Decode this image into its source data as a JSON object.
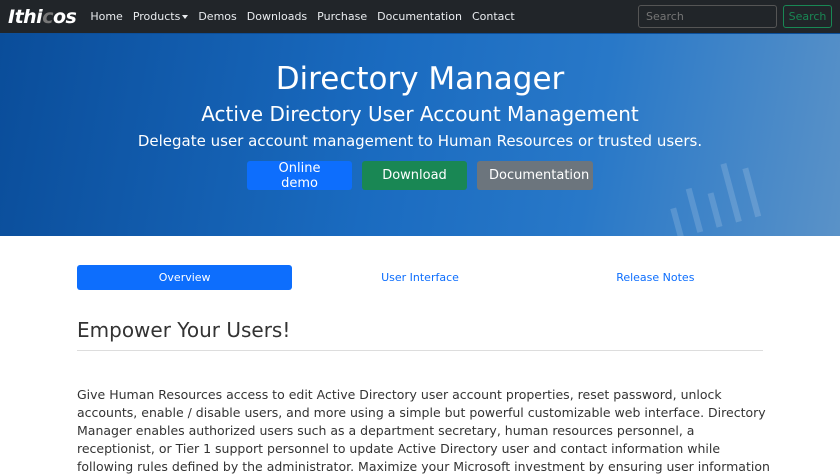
{
  "navbar": {
    "logo_prefix": "Ithi",
    "logo_accent": "c",
    "logo_suffix": "os",
    "items": [
      "Home",
      "Products",
      "Demos",
      "Downloads",
      "Purchase",
      "Documentation",
      "Contact"
    ],
    "search_placeholder": "Search",
    "search_button": "Search"
  },
  "hero": {
    "title": "Directory Manager",
    "subtitle": "Active Directory User Account Management",
    "tagline": "Delegate user account management to Human Resources or trusted users.",
    "buttons": [
      "Online demo",
      "Download",
      "Documentation"
    ]
  },
  "tabs": [
    "Overview",
    "User Interface",
    "Release Notes"
  ],
  "section": {
    "heading": "Empower Your Users!",
    "lines": [
      "Give Human Resources access to edit Active Directory user account properties, reset password, unlock",
      "accounts, enable / disable users, and more using a simple but powerful customizable web interface. Directory",
      "Manager enables authorized users such as a department secretary, human resources personnel, a",
      "receptionist, or Tier 1 support personnel to update Active Directory user and contact information while",
      "following rules defined by the administrator. Maximize your Microsoft investment by ensuring user information"
    ]
  },
  "colors": {
    "primary": "#0d6efd",
    "success": "#198754",
    "secondary": "#6c757d",
    "navbar": "#212529"
  }
}
